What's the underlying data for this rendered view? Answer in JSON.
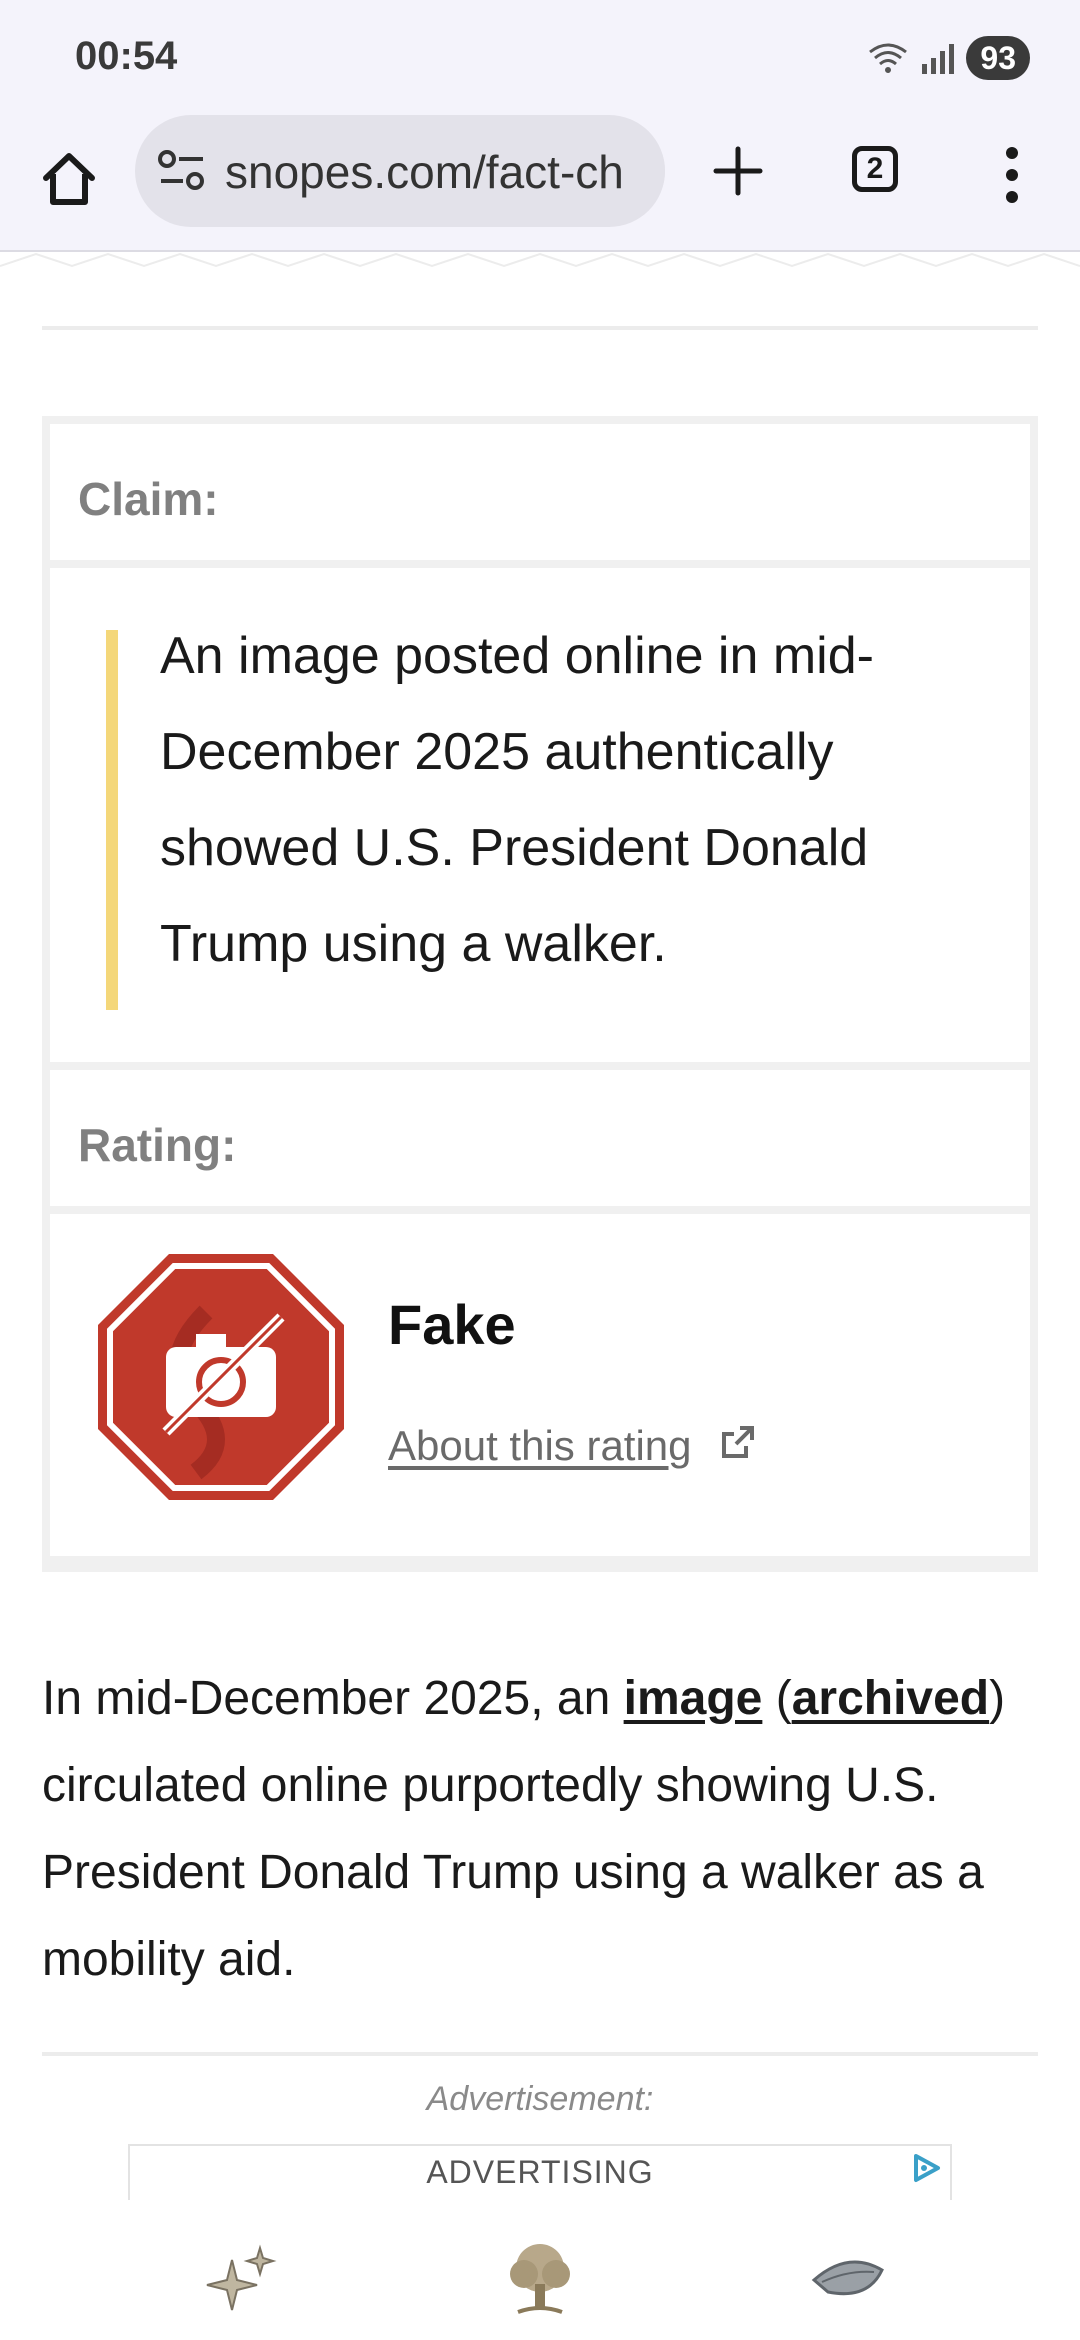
{
  "status_bar": {
    "time": "00:54",
    "battery": "93"
  },
  "browser": {
    "url": "snopes.com/fact-ch",
    "tab_count": "2",
    "icons": [
      "home-icon",
      "site-settings-icon",
      "plus-icon",
      "tabs-icon",
      "more-vert-icon"
    ]
  },
  "fact_check": {
    "claim_label": "Claim:",
    "claim_text": "An image posted online in mid-December 2025 authentically showed U.S. President Donald Trump using a walker.",
    "rating_label": "Rating:",
    "rating_value": "Fake",
    "rating_link": "About this rating",
    "colors": {
      "quote_bar": "#f4d77a",
      "rating_badge": "#c0392b"
    }
  },
  "article": {
    "p1_before": "In mid-December 2025, an ",
    "p1_link1": "image",
    "p1_mid1": " (",
    "p1_link2": "archived",
    "p1_after": ") circulated online purportedly showing U.S. President Donald Trump using a walker as a mobility aid."
  },
  "ad": {
    "label": "Advertisement:",
    "banner_text": "ADVERTISING"
  },
  "bottom_bar": {
    "icons": [
      "sparkle-icon",
      "tree-icon",
      "seed-icon"
    ]
  }
}
